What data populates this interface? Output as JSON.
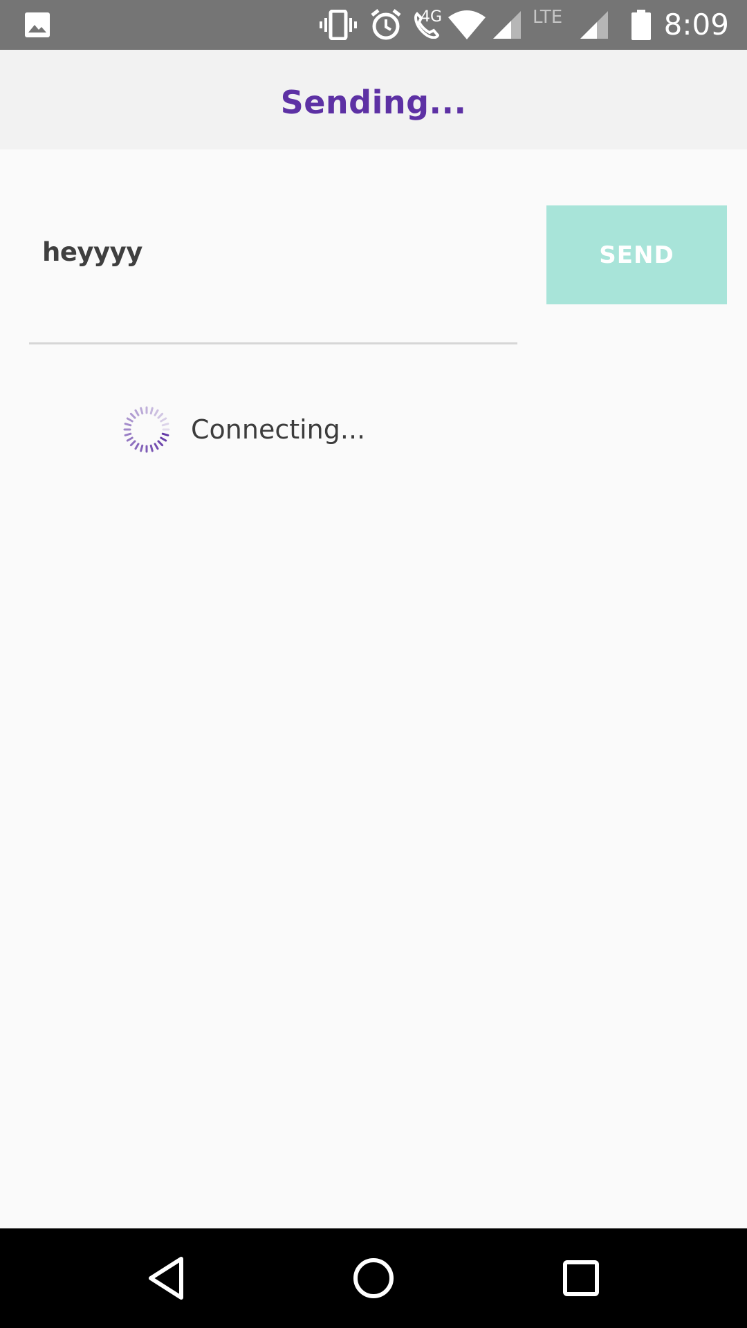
{
  "status_bar": {
    "time": "8:09",
    "network_label": "4G",
    "lte_label": "LTE",
    "icons": [
      "image-icon",
      "vibrate-icon",
      "alarm-icon",
      "wifi-calling-icon",
      "wifi-icon",
      "cell-signal-icon",
      "lte-signal-icon",
      "battery-icon"
    ]
  },
  "app_bar": {
    "title": "Sending...",
    "title_color": "#5d31a4"
  },
  "compose": {
    "message_value": "heyyyy",
    "send_label": "SEND",
    "send_color": "#a8e4d9"
  },
  "progress": {
    "label": "Connecting...",
    "spinner_color": "#5d31a4"
  },
  "nav_bar": {
    "icons": [
      "back-icon",
      "home-icon",
      "recents-icon"
    ]
  }
}
